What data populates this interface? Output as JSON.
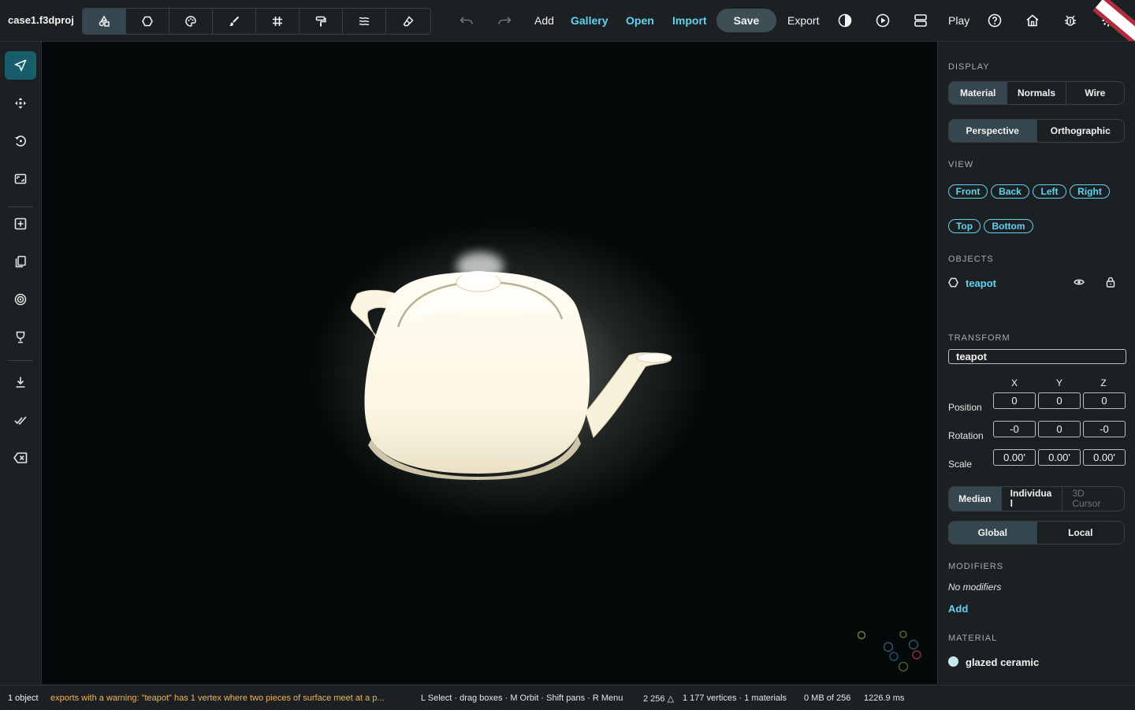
{
  "project": {
    "title": "case1.f3dproj"
  },
  "toolbar": {
    "modes": [
      {
        "icon": "shapes-icon",
        "active": true
      },
      {
        "icon": "object-mode-icon",
        "active": false
      },
      {
        "icon": "palette-icon",
        "active": false
      },
      {
        "icon": "brush-icon",
        "active": false
      },
      {
        "icon": "grid-icon",
        "active": false
      },
      {
        "icon": "paint-roller-icon",
        "active": false
      },
      {
        "icon": "layers-icon",
        "active": false
      },
      {
        "icon": "eraser-icon",
        "active": false
      }
    ],
    "undo_icon": "undo-icon",
    "redo_icon": "redo-icon",
    "add_label": "Add",
    "gallery_label": "Gallery",
    "open_label": "Open",
    "import_label": "Import",
    "save_label": "Save",
    "export_label": "Export",
    "play_label": "Play",
    "icons": [
      "contrast-icon",
      "play-circle-icon",
      "split-view-icon",
      "help-icon",
      "home-icon",
      "bug-icon",
      "settings-icon"
    ]
  },
  "left_tools": [
    {
      "icon": "select-arrow-icon",
      "active": true
    },
    {
      "icon": "move-icon"
    },
    {
      "icon": "rotate-icon"
    },
    {
      "icon": "frame-icon"
    },
    {
      "icon": "add-box-icon"
    },
    {
      "icon": "duplicate-icon"
    },
    {
      "icon": "target-icon"
    },
    {
      "icon": "goblet-icon"
    },
    {
      "icon": "download-icon"
    },
    {
      "icon": "check-icon"
    },
    {
      "icon": "backspace-icon"
    }
  ],
  "panel": {
    "display": {
      "heading": "DISPLAY",
      "shading": [
        "Material",
        "Normals",
        "Wire"
      ],
      "shading_active": "Material",
      "projection": [
        "Perspective",
        "Orthographic"
      ],
      "projection_active": "Perspective"
    },
    "view": {
      "heading": "VIEW",
      "buttons": [
        "Front",
        "Back",
        "Left",
        "Right",
        "Top",
        "Bottom"
      ]
    },
    "objects": {
      "heading": "OBJECTS",
      "items": [
        {
          "name": "teapot",
          "visible": true,
          "locked": true
        }
      ]
    },
    "transform": {
      "heading": "TRANSFORM",
      "name": "teapot",
      "axes": [
        "X",
        "Y",
        "Z"
      ],
      "position_label": "Position",
      "position": [
        "0",
        "0",
        "0"
      ],
      "rotation_label": "Rotation",
      "rotation": [
        "-0",
        "0",
        "-0"
      ],
      "scale_label": "Scale",
      "scale": [
        "0.00'",
        "0.00'",
        "0.00'"
      ],
      "pivot": [
        "Median",
        "Individua\nl",
        "3D\nCursor"
      ],
      "pivot_active": "Median",
      "space": [
        "Global",
        "Local"
      ],
      "space_active": "Global"
    },
    "modifiers": {
      "heading": "MODIFIERS",
      "empty": "No modifiers",
      "add_label": "Add"
    },
    "material": {
      "heading": "MATERIAL",
      "name": "glazed ceramic",
      "swatch": "#bfe9f2"
    }
  },
  "status": {
    "count": "1 object",
    "warning": "exports with a warning: \"teapot\" has 1 vertex where two pieces of surface meet at a p...",
    "hints": "L Select · drag boxes · M Orbit · Shift pans · R Menu",
    "faces": "2 256 △",
    "stats": "1 177 vertices · 1 materials",
    "memory": "0 MB of 256",
    "frame_time": "1226.9 ms"
  },
  "colors": {
    "accent": "#5fd3f0",
    "warning": "#f0b35a",
    "active_tool": "#175d6a",
    "viewport": "#040a0a"
  }
}
